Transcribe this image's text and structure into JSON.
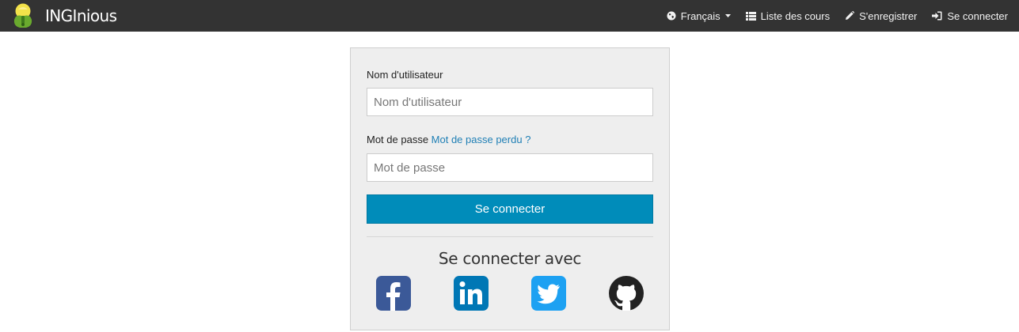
{
  "navbar": {
    "brand": "INGInious",
    "language_label": "Français",
    "courses_label": "Liste des cours",
    "register_label": "S'enregistrer",
    "login_label": "Se connecter"
  },
  "login_form": {
    "username_label": "Nom d'utilisateur",
    "username_placeholder": "Nom d'utilisateur",
    "password_label": "Mot de passe",
    "forgot_password_link": "Mot de passe perdu ?",
    "password_placeholder": "Mot de passe",
    "submit_label": "Se connecter"
  },
  "social": {
    "title": "Se connecter avec",
    "providers": [
      {
        "name": "facebook",
        "icon": "facebook-icon",
        "color": "#3b5998"
      },
      {
        "name": "linkedin",
        "icon": "linkedin-icon",
        "color": "#0077b5"
      },
      {
        "name": "twitter",
        "icon": "twitter-icon",
        "color": "#1da1f2"
      },
      {
        "name": "github",
        "icon": "github-icon",
        "color": "#222222"
      }
    ]
  },
  "colors": {
    "navbar_bg": "#333333",
    "primary_button": "#008cba",
    "link": "#1f7fb5",
    "panel_bg": "#eeeeee"
  }
}
